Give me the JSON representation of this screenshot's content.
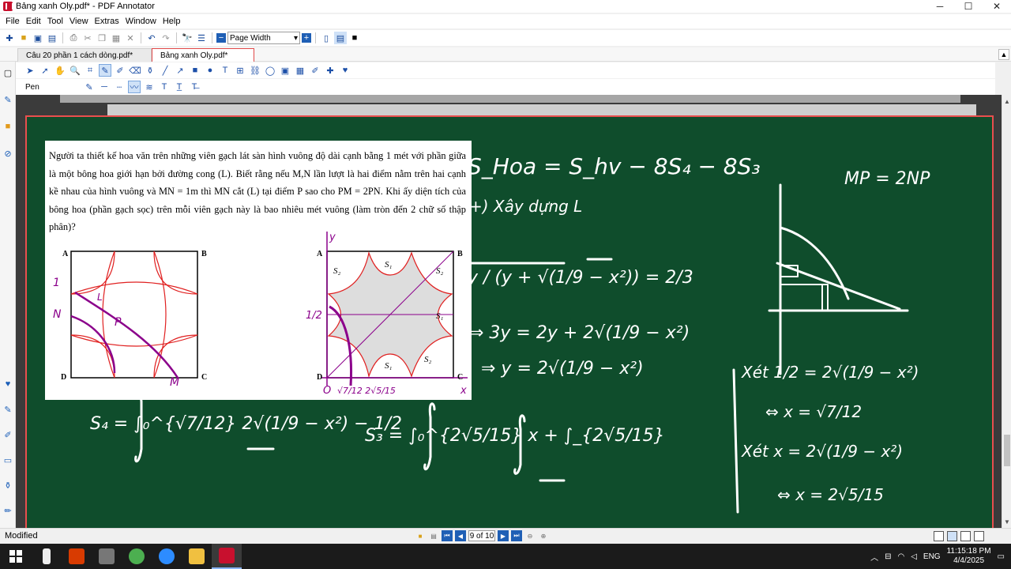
{
  "window": {
    "title": "Bảng xanh Oly.pdf* - PDF Annotator",
    "minimize": "─",
    "maximize": "☐",
    "close": "✕"
  },
  "menu": [
    "File",
    "Edit",
    "Tool",
    "View",
    "Extras",
    "Window",
    "Help"
  ],
  "toolbar": {
    "zoom_value": "Page Width"
  },
  "tabs": [
    {
      "label": "Câu 20 phần 1 cách dòng.pdf*",
      "active": false
    },
    {
      "label": "Bảng xanh Oly.pdf*",
      "active": true
    }
  ],
  "annotation_toolbar": {
    "current_tool": "Pen"
  },
  "problem": {
    "text": "Người ta thiết kế hoa văn trên những viên gạch lát sàn hình vuông độ dài cạnh bằng 1 mét với phần giữa là một bông hoa giới hạn bởi đường cong (L). Biết rằng nếu M,N lần lượt là hai điểm nằm trên hai cạnh kề nhau của hình vuông và MN = 1m thì MN cắt (L) tại điểm P sao cho PM = 2PN. Khi ấy diện tích của bông hoa (phần gạch sọc) trên mỗi viên gạch này là bao nhiêu mét vuông (làm tròn đến 2 chữ số thập phân)?",
    "fig1_labels": {
      "A": "A",
      "B": "B",
      "C": "C",
      "D": "D"
    },
    "fig2_labels": {
      "A": "A",
      "B": "B",
      "C": "C",
      "D": "D",
      "S1": "S₁",
      "S2": "S₂"
    },
    "handwriting": {
      "one": "1",
      "N": "N",
      "L": "L",
      "P": "P",
      "M": "M",
      "y": "y",
      "half": "1/2",
      "origin": "O",
      "x": "x",
      "ticks": "√7/12   2√5/15"
    }
  },
  "board": {
    "line1": "S_Hoa = S_hv − 8S₄ − 8S₃",
    "line2": "+) Xây dựng L",
    "frac_lhs": "y / (y + √(1/9 − x²)) = 2/3",
    "step1": "⇒ 3y = 2y + 2√(1/9 − x²)",
    "step2": "⇒ y = 2√(1/9 − x²)",
    "mp": "MP = 2NP",
    "check1": "Xét 1/2 = 2√(1/9 − x²)",
    "res1": "⇔ x = √7/12",
    "check2": "Xét x = 2√(1/9 − x²)",
    "res2": "⇔ x = 2√5/15",
    "s4": "S₄ = ∫₀^{√7/12} 2√(1/9 − x²) − 1/2",
    "s3": "S₃ = ∫₀^{2√5/15} x + ∫_{2√5/15}"
  },
  "status": {
    "text": "Modified",
    "page_indicator": "9 of 10"
  },
  "taskbar": {
    "language": "ENG",
    "time": "11:15:18 PM",
    "date": "4/4/2025"
  }
}
